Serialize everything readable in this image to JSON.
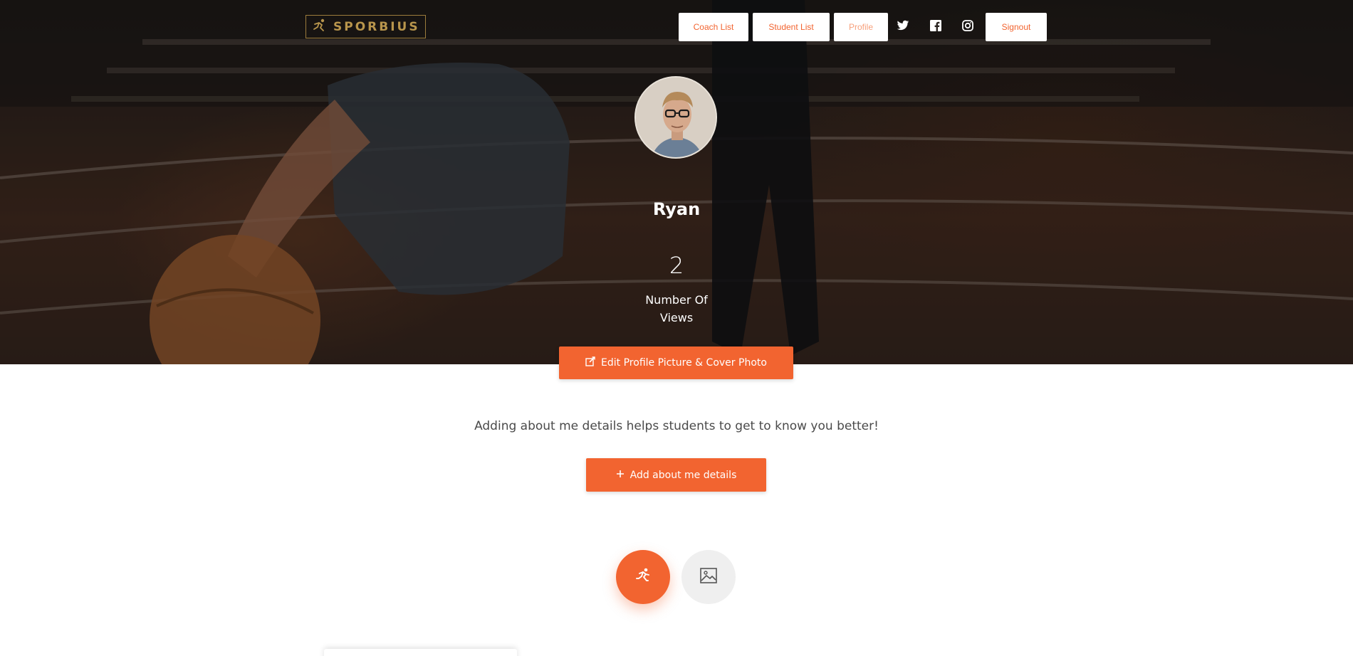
{
  "brand": {
    "name": "SPORBIUS"
  },
  "nav": {
    "coach_list": "Coach List",
    "student_list": "Student List",
    "profile": "Profile",
    "signout": "Signout",
    "social_icons": [
      "twitter-icon",
      "facebook-icon",
      "instagram-icon"
    ]
  },
  "profile": {
    "name": "Ryan",
    "views_count": "2",
    "views_label": "Number Of Views",
    "edit_button": "Edit Profile Picture & Cover Photo"
  },
  "about": {
    "message": "Adding about me details helps students to get to know you better!",
    "add_button": "Add about me details"
  },
  "tabs": {
    "icons": [
      "running-icon",
      "image-icon"
    ]
  },
  "colors": {
    "accent": "#f26430",
    "logo_gold": "#b8954c"
  }
}
